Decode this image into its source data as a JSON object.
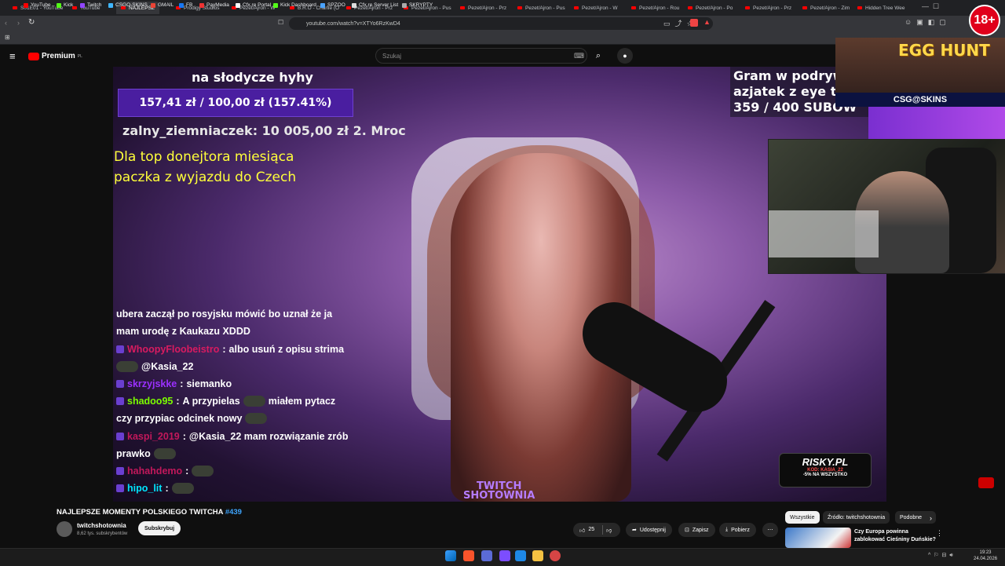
{
  "browser": {
    "tabs": [
      {
        "label": "S01E01 - YouTube"
      },
      {
        "label": "YouTube"
      },
      {
        "label": "NAJLEPSZ",
        "active": true
      },
      {
        "label": "Prodigy Studios"
      },
      {
        "label": "Pezet/Ajron - W"
      },
      {
        "label": "B.R.O - Charlie (O"
      },
      {
        "label": "Pezet/Ajron - Prz"
      },
      {
        "label": "Pezet/Ajron - Pus"
      },
      {
        "label": "Pezet/Ajron - Prz"
      },
      {
        "label": "Pezet/Ajron - Pus"
      },
      {
        "label": "Pezet/Ajron - W"
      },
      {
        "label": "Pezet/Ajron - Rou"
      },
      {
        "label": "Pezet/Ajron - Po"
      },
      {
        "label": "Pezet/Ajron - Prz"
      },
      {
        "label": "Pezet/Ajron - Zim"
      },
      {
        "label": "Hidden Tree Wee"
      }
    ],
    "url": "youtube.com/watch?v=XTYo6RzKwD4",
    "bookmarks": [
      "YouTube",
      "Kick",
      "Twitch",
      "CSGO-SKINS",
      "GMAIL",
      "FB",
      "PayMedia",
      "Cfx.re Portal",
      "Kick Dashboard",
      "SPZOO",
      "Cfx.re Server List",
      "SKRYPTY"
    ]
  },
  "youtube": {
    "logo": "Premium",
    "logo_region": "PL",
    "search_placeholder": "Szukaj"
  },
  "stream_overlay": {
    "goal_label": "na słodycze hyhy",
    "goal_progress": "157,41 zł  /  100,00 zł  (157.41%)",
    "top_donor": "zalny_ziemniaczek:  10 005,00 zł 2. Mroc",
    "donor_promo_line1": "Dla top donejtora miesiąca",
    "donor_promo_line2": "paczka z wyjazdu do Czech",
    "corner_line1": "Gram w podryw",
    "corner_line2": "azjatek z eye tra",
    "corner_line3": "359 / 400 SUBÓW",
    "watermark_line1": "TWITCH",
    "watermark_line2": "SHOTOWNIA",
    "risky_logo": "RISKY.PL",
    "risky_code": "KOD: KASIA_22",
    "risky_promo": "-5% NA WSZYSTKO"
  },
  "chat": [
    {
      "user": "",
      "text": "ubera zaczął po rosyjsku mówić bo uznał że ja",
      "color": "#ffffff"
    },
    {
      "user": "",
      "text": "mam urodę z Kaukazu XDDD",
      "color": "#ffffff"
    },
    {
      "user": "WhoopyFloobeistro",
      "text": "albo usuń z opisu strima",
      "color": "#d81b60"
    },
    {
      "user": "",
      "text": "@Kasia_22",
      "color": "#ffffff"
    },
    {
      "user": "skrzyjskke",
      "text": "siemanko",
      "color": "#9b30ff"
    },
    {
      "user": "shadoo95",
      "text": "A przypielas",
      "text2": "miałem pytacz",
      "color": "#7cfc00"
    },
    {
      "user": "",
      "text": "czy przypiac odcinek nowy",
      "color": "#ffffff"
    },
    {
      "user": "kaspi_2019",
      "text": "@Kasia_22 mam rozwiązanie zrób",
      "color": "#c2185b"
    },
    {
      "user": "",
      "text": "prawko",
      "color": "#ffffff"
    },
    {
      "user": "hahahdemo",
      "text": "",
      "color": "#c2185b"
    },
    {
      "user": "hipo_lit",
      "text": "",
      "color": "#00e5ff"
    }
  ],
  "ad": {
    "title": "EGG HUNT",
    "brand": "CSG@SKINS",
    "age_badge": "18+"
  },
  "video": {
    "title": "NAJLEPSZE MOMENTY POLSKIEGO TWITCHA",
    "hashtag": "#439",
    "channel": "twitchshotownia",
    "subscribers": "8,62 tys. subskrybentów",
    "subscribe_label": "Subskrybuj",
    "likes": "25",
    "share_label": "Udostępnij",
    "save_label": "Zapisz",
    "download_label": "Pobierz"
  },
  "sidebar": {
    "chips": [
      "Wszystkie",
      "Źródło: twitchshotownia",
      "Podobne"
    ],
    "recommended_title_line1": "Czy Europa powinna",
    "recommended_title_line2": "zablokować Cieśniny Duńskie?"
  },
  "taskbar": {
    "time": "19:23",
    "date": "24.04.2026"
  },
  "colors": {
    "accent": "#ff0000",
    "link": "#3ea6ff",
    "goal_bar": "#4a1ea0"
  }
}
